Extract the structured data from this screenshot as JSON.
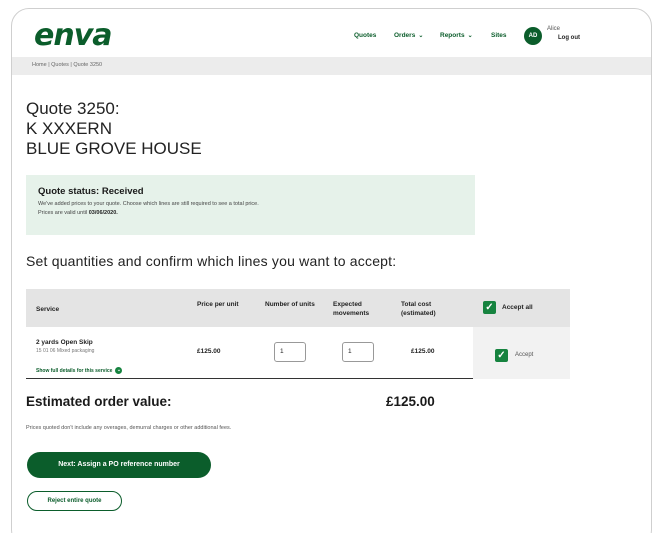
{
  "header": {
    "logo_text": "enva",
    "nav": {
      "quotes": "Quotes",
      "orders": "Orders",
      "reports": "Reports",
      "sites": "Sites",
      "chevron": "⌄"
    },
    "user": {
      "initials": "AD",
      "name": "Alice",
      "logout": "Log out"
    }
  },
  "breadcrumb": "Home | Quotes | Quote 3250",
  "quote": {
    "title_line1": "Quote 3250:",
    "title_line2": "K      XXXERN",
    "title_line3": "BLUE GROVE HOUSE"
  },
  "status": {
    "title": "Quote status: Received",
    "text1": "We've added prices to your quote. Choose which lines are still required to see a total price.",
    "text2_prefix": "Prices are valid until ",
    "valid_until": "03/06/2020."
  },
  "section_heading": "Set quantities and confirm which lines you want to accept:",
  "table": {
    "headers": {
      "service": "Service",
      "price": "Price per unit",
      "units": "Number of units",
      "movements": "Expected movements",
      "total": "Total cost (estimated)",
      "accept_all": "Accept all"
    },
    "rows": [
      {
        "service": "2 yards Open Skip",
        "sub": "15 01 06 Mixed packaging",
        "details_link": "Show full details for this service",
        "price": "£125.00",
        "units": "1",
        "movements": "1",
        "total": "£125.00",
        "accept_label": "Accept",
        "accepted": true
      }
    ]
  },
  "estimate": {
    "label": "Estimated order value:",
    "value": "£125.00",
    "disclaimer": "Prices quoted don't include any overages, demurral charges or other additional fees."
  },
  "buttons": {
    "next": "Next: Assign a PO reference number",
    "reject": "Reject entire quote"
  },
  "icons": {
    "check": "✓",
    "details": "⌄"
  },
  "colors": {
    "brand": "#0b5d2b",
    "accent": "#16833f",
    "status_bg": "#e6f2ea"
  }
}
